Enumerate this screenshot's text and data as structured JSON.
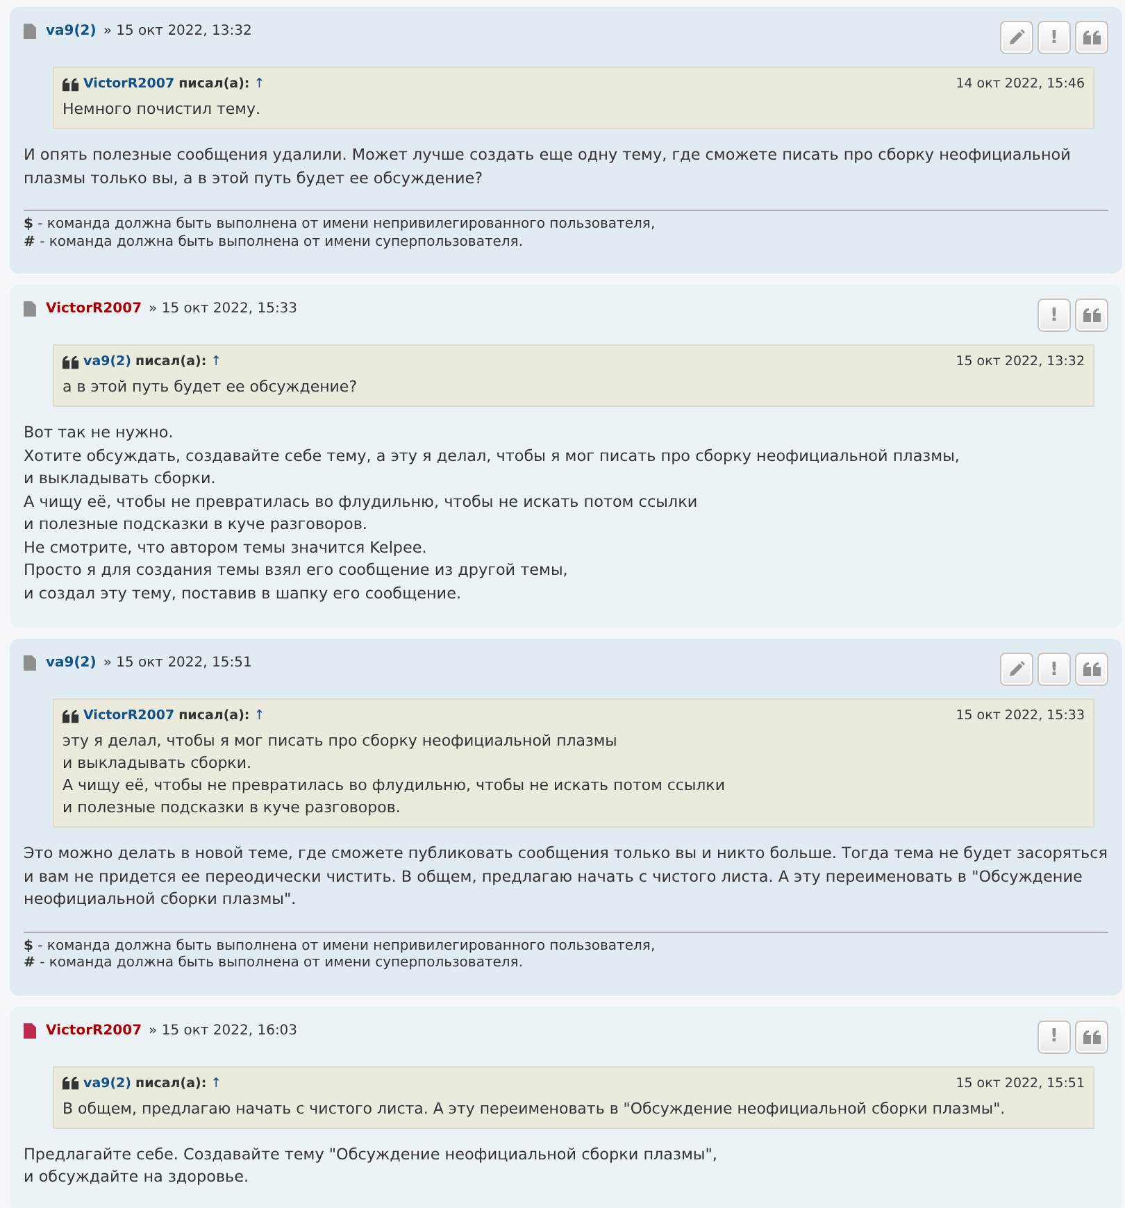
{
  "posts": [
    {
      "unread": false,
      "author": {
        "name": "va9(2)",
        "color": "#105289"
      },
      "date": "» 15 окт 2022, 13:32",
      "buttons": [
        {
          "kind": "edit"
        },
        {
          "kind": "report",
          "label": "!"
        },
        {
          "kind": "quote"
        }
      ],
      "quote": {
        "author_name": "VictorR2007",
        "wrote": "писал(а):",
        "arrow": "↑",
        "date": "14 окт 2022, 15:46",
        "lines": [
          "Немного почистил тему."
        ]
      },
      "body": [
        "И опять полезные сообщения удалили. Может лучше создать еще одну тему, где сможете писать про сборку неофициальной плазмы только вы, а в этой путь будет ее обсуждение?"
      ],
      "signature": [
        "**$** - команда должна быть выполнена от имени непривилегированного пользователя,",
        "**#** - команда должна быть выполнена от имени суперпользователя."
      ]
    },
    {
      "unread": false,
      "author": {
        "name": "VictorR2007",
        "color": "#aa0000"
      },
      "date": "» 15 окт 2022, 15:33",
      "buttons": [
        {
          "kind": "report",
          "label": "!"
        },
        {
          "kind": "quote"
        }
      ],
      "quote": {
        "author_name": "va9(2)",
        "wrote": "писал(а):",
        "arrow": "↑",
        "date": "15 окт 2022, 13:32",
        "lines": [
          "а в этой путь будет ее обсуждение?"
        ]
      },
      "body": [
        "Вот так не нужно.",
        "Хотите обсуждать, создавайте себе тему, а эту я делал, чтобы я мог писать про сборку неофициальной плазмы,",
        "и выкладывать сборки.",
        "А чищу её, чтобы не превратилась во флудильню, чтобы не искать потом ссылки",
        "и полезные подсказки в куче разговоров.",
        "Не смотрите, что автором темы значится Kelpee.",
        "Просто я для создания темы взял его сообщение из другой темы,",
        "и создал эту тему, поставив в шапку его сообщение."
      ]
    },
    {
      "unread": false,
      "author": {
        "name": "va9(2)",
        "color": "#105289"
      },
      "date": "» 15 окт 2022, 15:51",
      "buttons": [
        {
          "kind": "edit"
        },
        {
          "kind": "report",
          "label": "!"
        },
        {
          "kind": "quote"
        }
      ],
      "quote": {
        "author_name": "VictorR2007",
        "wrote": "писал(а):",
        "arrow": "↑",
        "date": "15 окт 2022, 15:33",
        "lines": [
          "эту я делал, чтобы я мог писать про сборку неофициальной плазмы",
          "и выкладывать сборки.",
          "А чищу её, чтобы не превратилась во флудильню, чтобы не искать потом ссылки",
          "и полезные подсказки в куче разговоров."
        ]
      },
      "body": [
        "Это можно делать в новой теме, где сможете публиковать сообщения только вы и никто больше. Тогда тема не будет засоряться и вам не придется ее переодически чистить. В общем, предлагаю начать с чистого листа. А эту переименовать в \"Обсуждение неофициальной сборки плазмы\"."
      ],
      "signature": [
        "**$** - команда должна быть выполнена от имени непривилегированного пользователя,",
        "**#** - команда должна быть выполнена от имени суперпользователя."
      ]
    },
    {
      "unread": true,
      "author": {
        "name": "VictorR2007",
        "color": "#aa0000"
      },
      "date": "» 15 окт 2022, 16:03",
      "buttons": [
        {
          "kind": "report",
          "label": "!"
        },
        {
          "kind": "quote"
        }
      ],
      "quote": {
        "author_name": "va9(2)",
        "wrote": "писал(а):",
        "arrow": "↑",
        "date": "15 окт 2022, 15:51",
        "lines": [
          "В общем, предлагаю начать с чистого листа. А эту переименовать в \"Обсуждение неофициальной сборки плазмы\"."
        ]
      },
      "body": [
        "Предлагайте себе. Создавайте тему \"Обсуждение неофициальной сборки плазмы\",",
        "и обсуждайте на здоровье."
      ]
    }
  ]
}
